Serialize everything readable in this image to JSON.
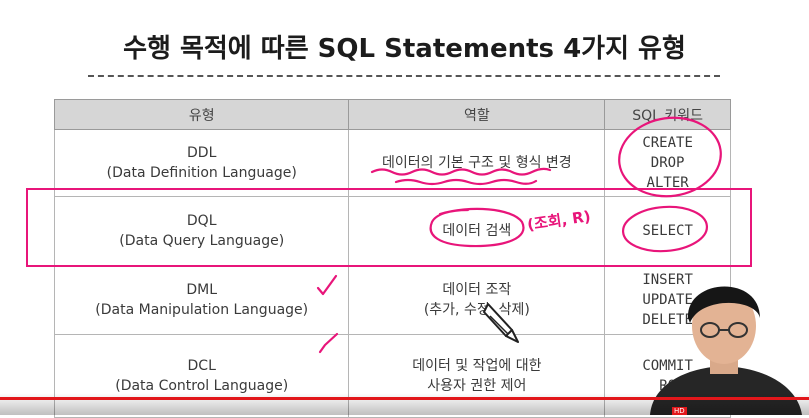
{
  "slide": {
    "title": "수행 목적에 따른 SQL Statements 4가지 유형",
    "table": {
      "headers": [
        "유형",
        "역할",
        "SQL 키워드"
      ],
      "rows": [
        {
          "type": "DDL",
          "type_full": "(Data Definition Language)",
          "role": "데이터의 기본 구조 및 형식 변경",
          "role2": "",
          "keywords": [
            "CREATE",
            "DROP",
            "ALTER"
          ]
        },
        {
          "type": "DQL",
          "type_full": "(Data Query Language)",
          "role": "데이터 검색",
          "role2": "",
          "keywords": [
            "SELECT"
          ]
        },
        {
          "type": "DML",
          "type_full": "(Data Manipulation Language)",
          "role": "데이터 조작",
          "role2": "(추가, 수정, 삭제)",
          "keywords": [
            "INSERT",
            "UPDATE",
            "DELETE"
          ]
        },
        {
          "type": "DCL",
          "type_full": "(Data Control Language)",
          "role": "데이터 및 작업에 대한",
          "role2": "사용자 권한 제어",
          "keywords": [
            "COMMIT",
            "RO"
          ]
        }
      ]
    },
    "handwritten_note": "(조회, R)"
  },
  "player": {
    "hd_label": "HD"
  },
  "colors": {
    "annotation": "#e8157a",
    "progress": "#e2171b",
    "header_bg": "#d6d6d6"
  }
}
